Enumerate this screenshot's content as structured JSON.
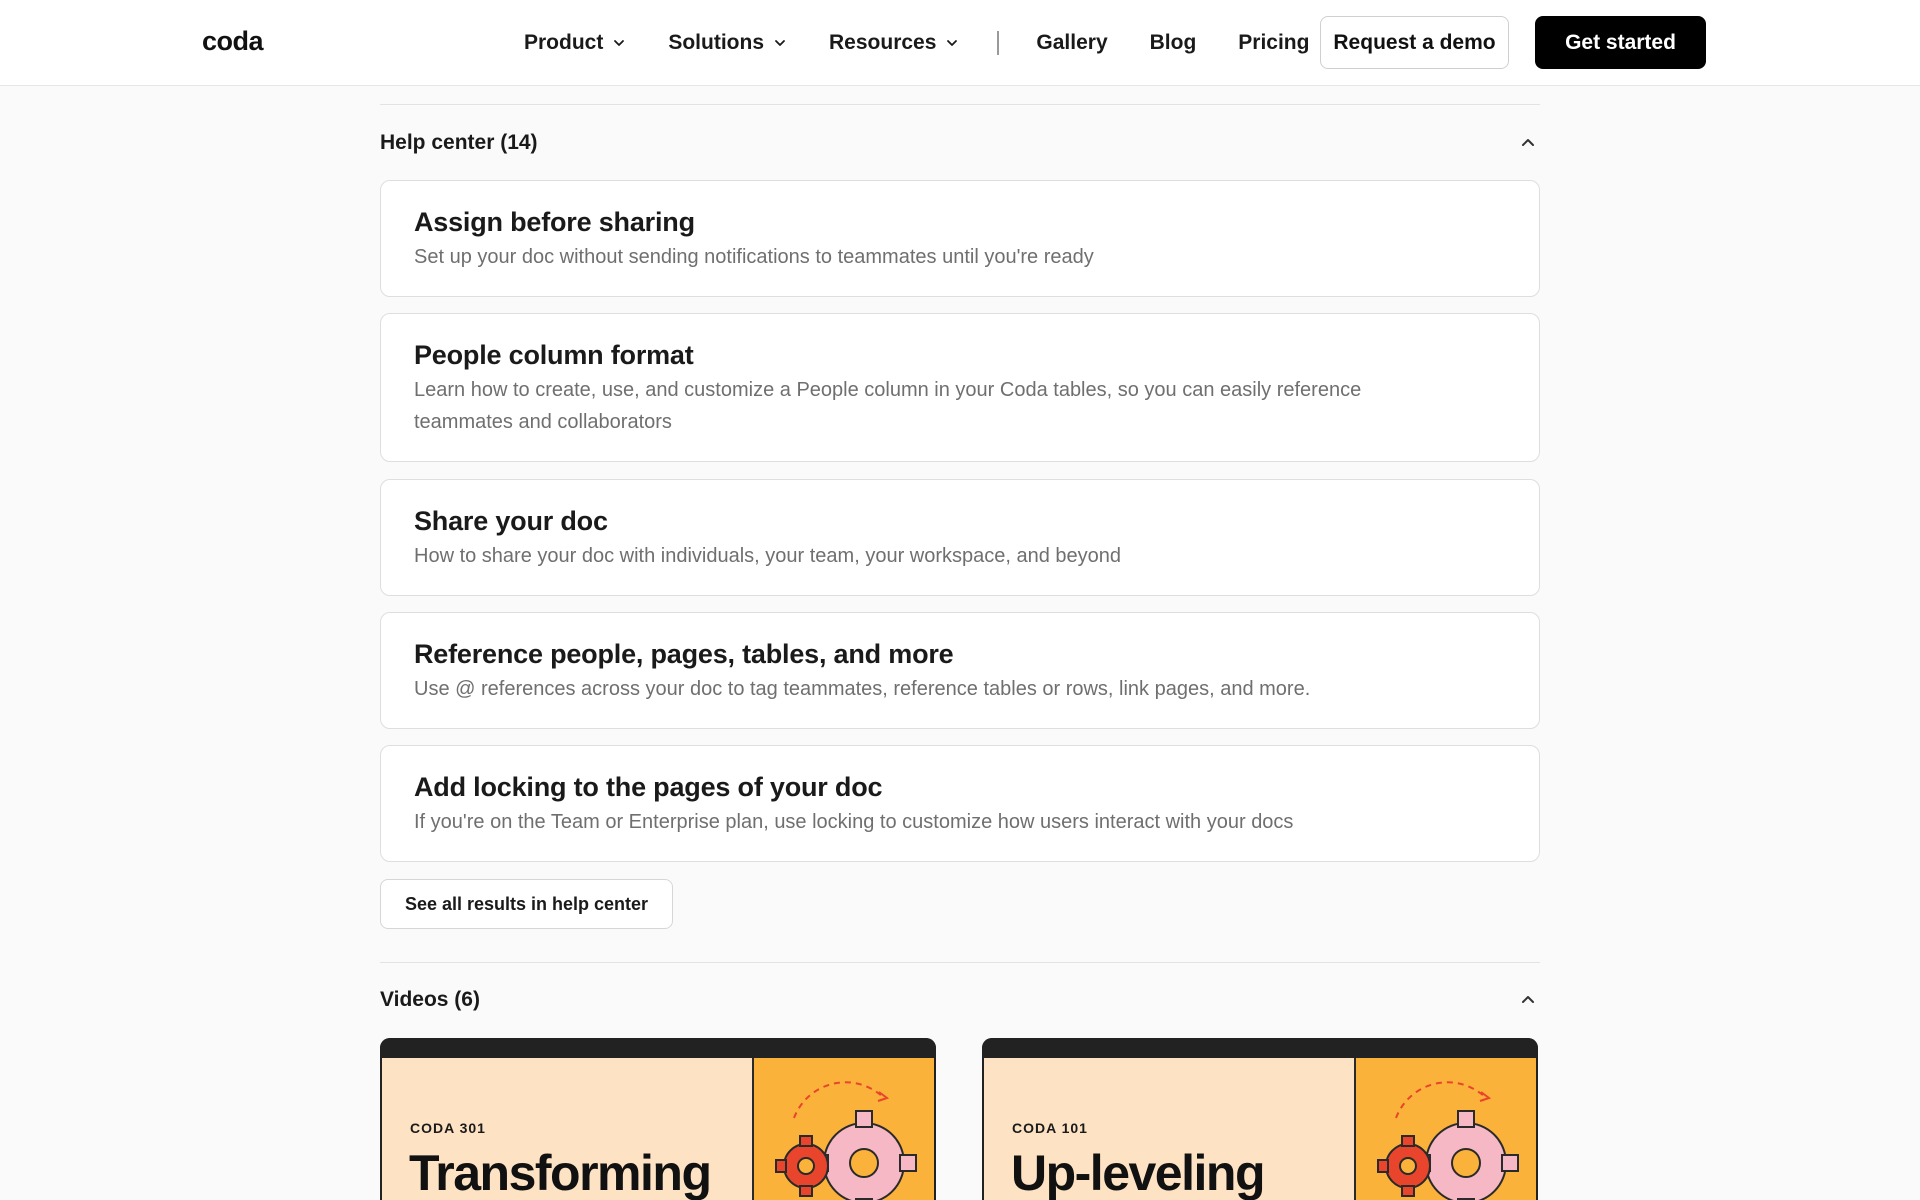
{
  "header": {
    "logo": "coda",
    "nav": [
      {
        "label": "Product",
        "has_dropdown": true
      },
      {
        "label": "Solutions",
        "has_dropdown": true
      },
      {
        "label": "Resources",
        "has_dropdown": true
      }
    ],
    "links": [
      "Gallery",
      "Blog",
      "Pricing"
    ],
    "request_demo": "Request a demo",
    "get_started": "Get started",
    "chevron_icon": "chevron-down-icon"
  },
  "help_center": {
    "title": "Help center (14)",
    "collapse_icon": "chevron-up-icon",
    "articles": [
      {
        "title": "Assign before sharing",
        "description": "Set up your doc without sending notifications to teammates until you're ready"
      },
      {
        "title": "People column format",
        "description": "Learn how to create, use, and customize a People column in your Coda tables, so you can easily reference teammates and collaborators"
      },
      {
        "title": "Share your doc",
        "description": "How to share your doc with individuals, your team, your workspace, and beyond"
      },
      {
        "title": "Reference people, pages, tables, and more",
        "description": "Use @ references across your doc to tag teammates, reference tables or rows, link pages, and more."
      },
      {
        "title": "Add locking to the pages of your doc",
        "description": "If you're on the Team or Enterprise plan, use locking to customize how users interact with your docs"
      }
    ],
    "see_all": "See all results in help center"
  },
  "videos": {
    "title": "Videos (6)",
    "collapse_icon": "chevron-up-icon",
    "items": [
      {
        "kicker": "CODA 301",
        "title": "Transforming a Google doc"
      },
      {
        "kicker": "CODA 101",
        "title": "Up-leveling your team hub"
      }
    ],
    "colors": {
      "card_bg": "#fde2c4",
      "art_bg": "#fbb23b",
      "gear_red": "#e8452c",
      "gear_pink": "#f5b8c4"
    }
  }
}
